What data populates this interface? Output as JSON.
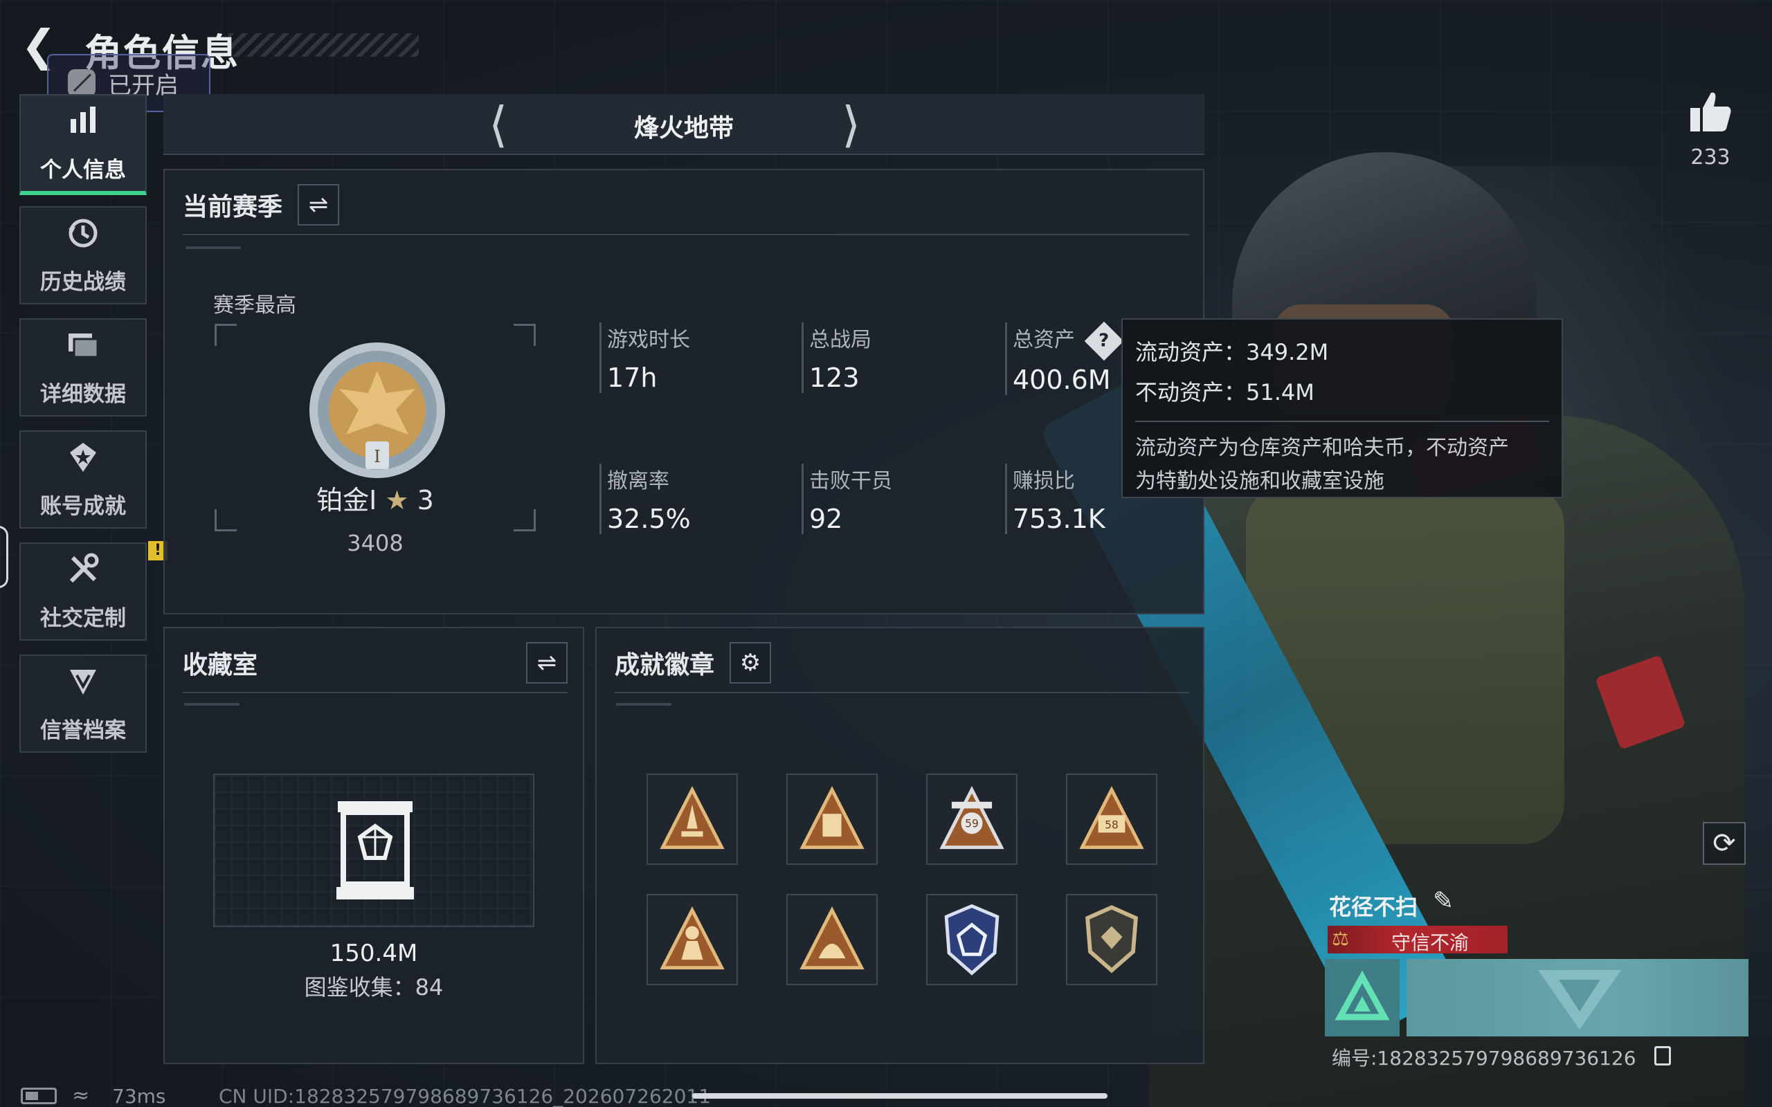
{
  "header": {
    "title": "角色信息",
    "status_badge": "已开启"
  },
  "sidebar": {
    "items": [
      {
        "label": "个人信息",
        "icon": "bar-chart-icon",
        "active": true
      },
      {
        "label": "历史战绩",
        "icon": "history-icon"
      },
      {
        "label": "详细数据",
        "icon": "folder-icon"
      },
      {
        "label": "账号成就",
        "icon": "achievement-icon"
      },
      {
        "label": "社交定制",
        "icon": "tools-icon",
        "alert": "!"
      },
      {
        "label": "信誉档案",
        "icon": "credit-icon"
      }
    ]
  },
  "mode": {
    "title": "烽火地带"
  },
  "season": {
    "title": "当前赛季",
    "best_label": "赛季最高",
    "rank_name": "铂金Ⅰ",
    "rank_stars": "3",
    "rank_score": "3408",
    "stats": [
      {
        "label": "游戏时长",
        "value": "17h"
      },
      {
        "label": "总战局",
        "value": "123"
      },
      {
        "label": "总资产",
        "value": "400.6M"
      },
      {
        "label": "撤离率",
        "value": "32.5%"
      },
      {
        "label": "击败干员",
        "value": "92"
      },
      {
        "label": "赚损比",
        "value": "753.1K"
      }
    ]
  },
  "tooltip": {
    "liquid": "流动资产：349.2M",
    "fixed": "不动资产：51.4M",
    "desc_line1": "流动资产为仓库资产和哈夫币，不动资产",
    "desc_line2": "为特勤处设施和收藏室设施"
  },
  "vault": {
    "title": "收藏室",
    "value": "150.4M",
    "collection": "图鉴收集：84"
  },
  "badges": {
    "title": "成就徽章",
    "items": [
      "badge-rocket",
      "badge-cargo",
      "badge-59",
      "badge-58",
      "badge-soldier",
      "badge-siren",
      "badge-shield-crown",
      "badge-crest"
    ]
  },
  "profile": {
    "likes": "233",
    "name": "花径不扫",
    "title_tag": "守信不渝",
    "uid_label": "编号:1828325797986897361​26"
  },
  "footer": {
    "ping": "73ms",
    "uid": "CN UID:1828325797986897361​26_202607262011"
  },
  "colors": {
    "accent": "#3fd18e",
    "tag_red": "#b3262d",
    "team_teal": "#5d98a1"
  }
}
